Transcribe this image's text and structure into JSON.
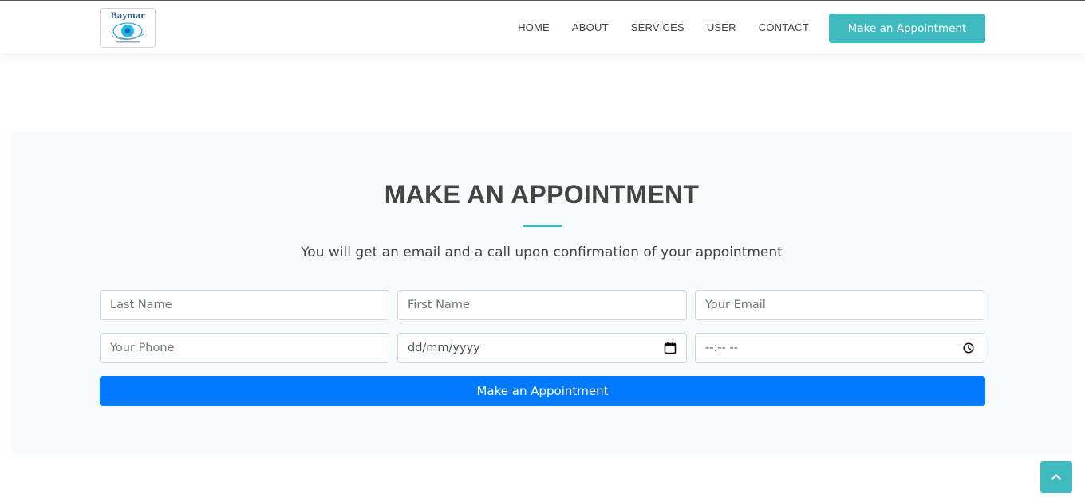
{
  "header": {
    "logo_text": "Baymar",
    "nav": [
      {
        "label": "HOME"
      },
      {
        "label": "ABOUT"
      },
      {
        "label": "SERVICES"
      },
      {
        "label": "USER"
      },
      {
        "label": "CONTACT"
      }
    ],
    "cta_label": "Make an Appointment"
  },
  "appointment": {
    "title": "MAKE AN APPOINTMENT",
    "subtitle": "You will get an email and a call upon confirmation of your appointment",
    "fields": {
      "last_name_placeholder": "Last Name",
      "first_name_placeholder": "First Name",
      "email_placeholder": "Your Email",
      "phone_placeholder": "Your Phone",
      "date_value": "dd/mm/yyyy",
      "time_value": "--:-- --"
    },
    "submit_label": "Make an Appointment"
  },
  "icons": {
    "calendar": "calendar-icon",
    "clock": "clock-icon",
    "back_to_top": "chevron-up-icon"
  },
  "colors": {
    "accent": "#3fbbc0",
    "primary_button": "#007bff",
    "section_bg": "#f7fbfc",
    "text": "#444444"
  }
}
